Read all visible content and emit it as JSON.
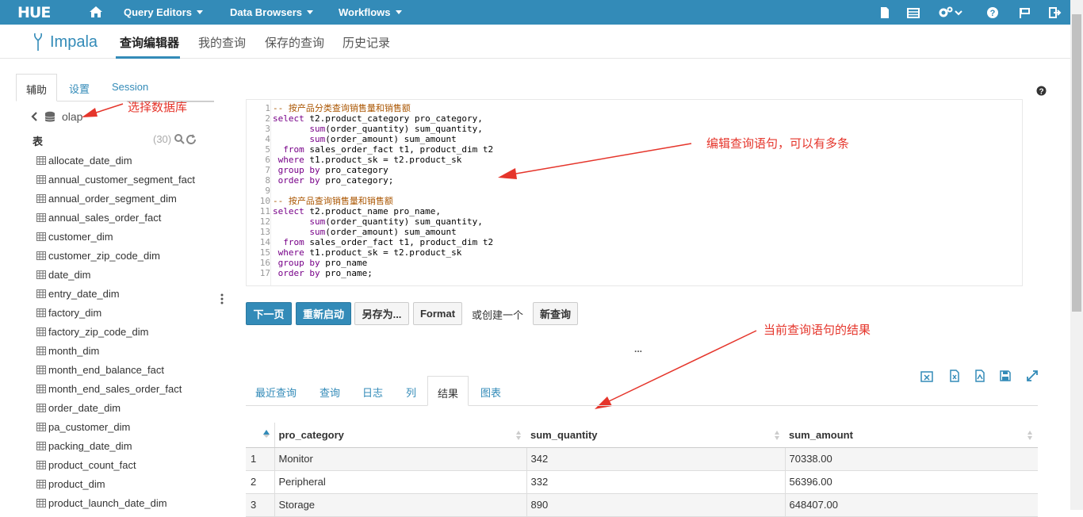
{
  "topbar": {
    "logo": "HUE",
    "menus": [
      {
        "label": "Query Editors"
      },
      {
        "label": "Data Browsers"
      },
      {
        "label": "Workflows"
      }
    ]
  },
  "app": {
    "name": "Impala",
    "tabs": [
      "查询编辑器",
      "我的查询",
      "保存的查询",
      "历史记录"
    ]
  },
  "left": {
    "tabs": [
      "辅助",
      "设置",
      "Session"
    ],
    "database": "olap",
    "tables_header": "表",
    "table_count": "(30)",
    "tables": [
      "allocate_date_dim",
      "annual_customer_segment_fact",
      "annual_order_segment_dim",
      "annual_sales_order_fact",
      "customer_dim",
      "customer_zip_code_dim",
      "date_dim",
      "entry_date_dim",
      "factory_dim",
      "factory_zip_code_dim",
      "month_dim",
      "month_end_balance_fact",
      "month_end_sales_order_fact",
      "order_date_dim",
      "pa_customer_dim",
      "packing_date_dim",
      "product_count_fact",
      "product_dim",
      "product_launch_date_dim"
    ]
  },
  "editor": {
    "lines": [
      "-- 按产品分类查询销售量和销售额",
      "select t2.product_category pro_category,",
      "       sum(order_quantity) sum_quantity,",
      "       sum(order_amount) sum_amount",
      "  from sales_order_fact t1, product_dim t2",
      " where t1.product_sk = t2.product_sk",
      " group by pro_category",
      " order by pro_category;",
      "",
      "-- 按产品查询销售量和销售额",
      "select t2.product_name pro_name,",
      "       sum(order_quantity) sum_quantity,",
      "       sum(order_amount) sum_amount",
      "  from sales_order_fact t1, product_dim t2",
      " where t1.product_sk = t2.product_sk",
      " group by pro_name",
      " order by pro_name;"
    ]
  },
  "toolbar": {
    "next_page": "下一页",
    "restart": "重新启动",
    "save_as": "另存为...",
    "format": "Format",
    "or_create": "或创建一个",
    "new_query": "新查询",
    "more": "..."
  },
  "annotations": {
    "select_db": "选择数据库",
    "edit_query": "编辑查询语句，可以有多条",
    "current_result": "当前查询语句的结果"
  },
  "results": {
    "tabs": [
      "最近查询",
      "查询",
      "日志",
      "列",
      "结果",
      "图表"
    ],
    "active_tab": "结果",
    "columns": [
      "pro_category",
      "sum_quantity",
      "sum_amount"
    ],
    "rows": [
      {
        "idx": "1",
        "pro_category": "Monitor",
        "sum_quantity": "342",
        "sum_amount": "70338.00"
      },
      {
        "idx": "2",
        "pro_category": "Peripheral",
        "sum_quantity": "332",
        "sum_amount": "56396.00"
      },
      {
        "idx": "3",
        "pro_category": "Storage",
        "sum_quantity": "890",
        "sum_amount": "648407.00"
      }
    ]
  },
  "colors": {
    "accent": "#338bb8",
    "annotation": "#e5352b"
  }
}
